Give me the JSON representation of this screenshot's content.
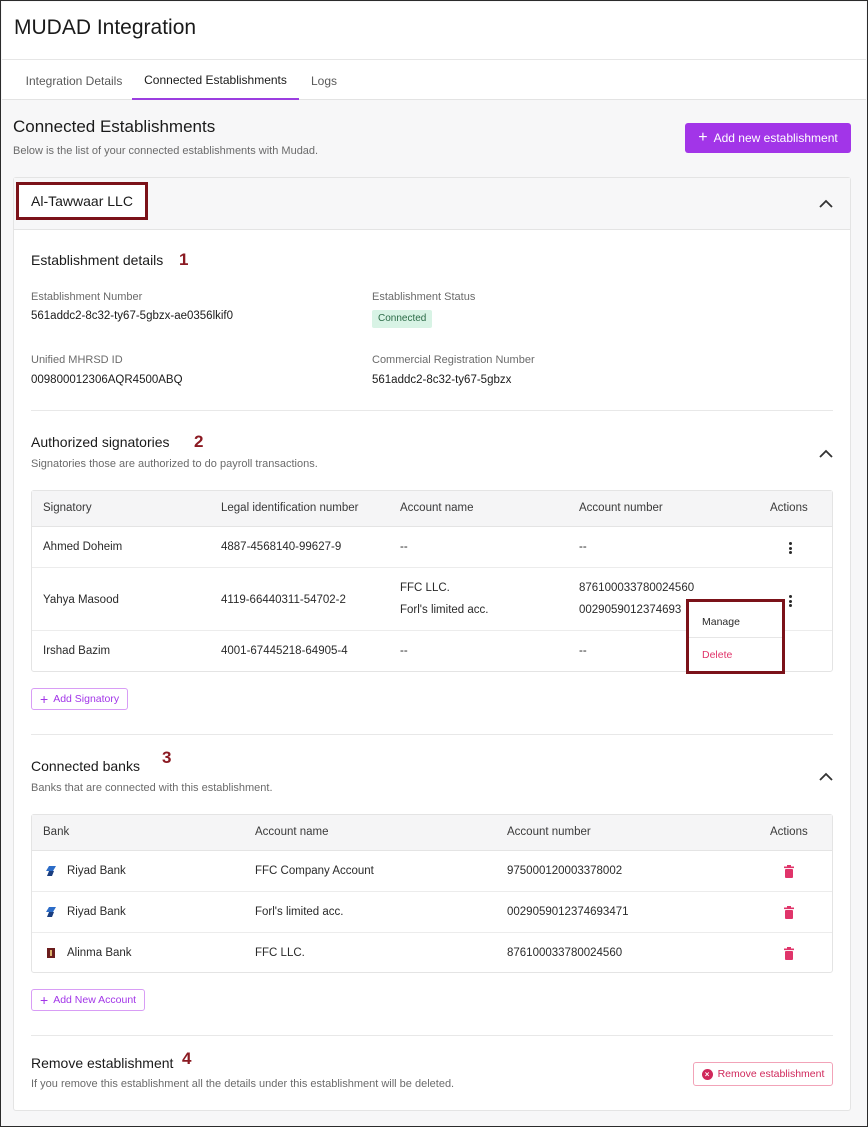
{
  "app": {
    "title": "MUDAD Integration"
  },
  "tabs": [
    {
      "label": "Integration Details",
      "active": false
    },
    {
      "label": "Connected Establishments",
      "active": true
    },
    {
      "label": "Logs",
      "active": false
    }
  ],
  "page": {
    "title": "Connected Establishments",
    "subtitle": "Below is the list of your connected establishments with Mudad.",
    "add_button": "Add new establishment"
  },
  "establishment": {
    "name": "Al-Tawwaar LLC",
    "details": {
      "title": "Establishment details",
      "marker": "1",
      "fields": [
        {
          "label": "Establishment Number",
          "value": "561addc2-8c32-ty67-5gbzx-ae0356lkif0"
        },
        {
          "label": "Establishment Status",
          "value": "Connected"
        },
        {
          "label": "Unified MHRSD ID",
          "value": "009800012306AQR4500ABQ"
        },
        {
          "label": "Commercial Registration Number",
          "value": "561addc2-8c32-ty67-5gbzx"
        }
      ]
    },
    "signatories": {
      "title": "Authorized signatories",
      "marker": "2",
      "description": "Signatories those are authorized to do payroll transactions.",
      "columns": [
        "Signatory",
        "Legal identification number",
        "Account name",
        "Account number",
        "Actions"
      ],
      "rows": [
        {
          "name": "Ahmed Doheim",
          "legal_id": "4887-4568140-99627-9",
          "account_names": [
            "--"
          ],
          "account_numbers": [
            "--"
          ]
        },
        {
          "name": "Yahya Masood",
          "legal_id": "4119-66440311-54702-2",
          "account_names": [
            "FFC LLC.",
            "Forl's limited acc."
          ],
          "account_numbers": [
            "876100033780024560",
            "0029059012374693"
          ]
        },
        {
          "name": "Irshad Bazim",
          "legal_id": "4001-67445218-64905-4",
          "account_names": [
            "--"
          ],
          "account_numbers": [
            "--"
          ]
        }
      ],
      "add_button": "Add Signatory",
      "menu": {
        "manage": "Manage",
        "delete": "Delete"
      }
    },
    "banks": {
      "title": "Connected banks",
      "marker": "3",
      "description": "Banks that are connected with this establishment.",
      "columns": [
        "Bank",
        "Account name",
        "Account number",
        "Actions"
      ],
      "rows": [
        {
          "bank": "Riyad Bank",
          "account_name": "FFC Company Account",
          "account_number": "975000120003378002",
          "icon": "riyad-bank-logo-icon"
        },
        {
          "bank": "Riyad Bank",
          "account_name": "Forl's limited acc.",
          "account_number": "0029059012374693471",
          "icon": "riyad-bank-logo-icon"
        },
        {
          "bank": "Alinma Bank",
          "account_name": "FFC LLC.",
          "account_number": "876100033780024560",
          "icon": "alinma-bank-logo-icon"
        }
      ],
      "add_button": "Add New Account"
    },
    "remove": {
      "title": "Remove establishment",
      "marker": "4",
      "description": "If you remove this establishment all the details under this establishment will be deleted.",
      "button": "Remove establishment"
    }
  },
  "colors": {
    "accent": "#a235e8",
    "annotation": "#7b1219",
    "danger": "#d0285b",
    "success_bg": "#d8f3e5"
  }
}
